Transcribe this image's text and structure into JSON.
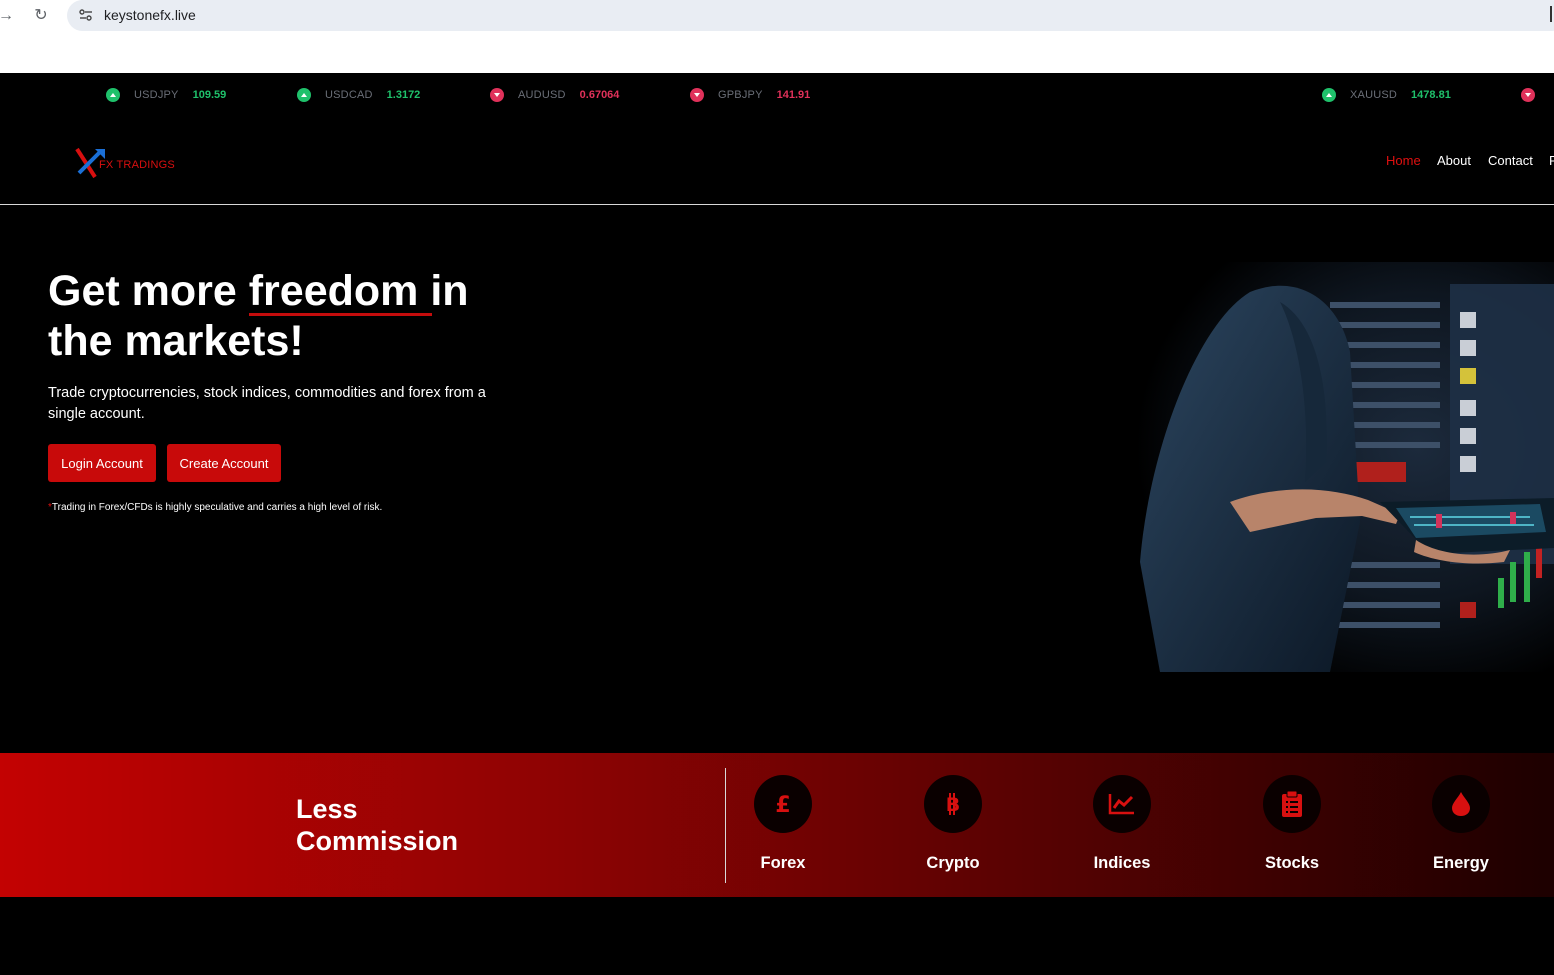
{
  "browser": {
    "url": "keystonefx.live"
  },
  "ticker": [
    {
      "symbol": "USDJPY",
      "value": "109.59",
      "direction": "up"
    },
    {
      "symbol": "USDCAD",
      "value": "1.3172",
      "direction": "up"
    },
    {
      "symbol": "AUDUSD",
      "value": "0.67064",
      "direction": "down"
    },
    {
      "symbol": "GPBJPY",
      "value": "141.91",
      "direction": "down"
    },
    {
      "symbol": "XAUUSD",
      "value": "1478.81",
      "direction": "up"
    }
  ],
  "header": {
    "logo_text": "FX TRADINGS",
    "nav": [
      {
        "label": "Home",
        "active": true
      },
      {
        "label": "About",
        "active": false
      },
      {
        "label": "Contact",
        "active": false
      },
      {
        "label": "F",
        "active": false
      }
    ]
  },
  "hero": {
    "title_line1_a": "Get more ",
    "title_line1_b": "freedom",
    "title_line1_c": " in",
    "title_line2": "the markets!",
    "subtitle": "Trade cryptocurrencies, stock indices, commodities and forex from a single account.",
    "login_label": "Login Account",
    "create_label": "Create Account",
    "risk_star": "*",
    "risk_text": "Trading in Forex/CFDs is highly speculative and carries a high level of risk."
  },
  "band": {
    "title": "Less Commission",
    "markets": [
      {
        "label": "Forex",
        "icon": "pound-icon"
      },
      {
        "label": "Crypto",
        "icon": "bitcoin-icon"
      },
      {
        "label": "Indices",
        "icon": "chart-line-icon"
      },
      {
        "label": "Stocks",
        "icon": "clipboard-icon"
      },
      {
        "label": "Energy",
        "icon": "drop-icon"
      }
    ]
  },
  "colors": {
    "accent_red": "#c80a0a",
    "up_green": "#1fc16b",
    "down_red": "#e0315a"
  }
}
